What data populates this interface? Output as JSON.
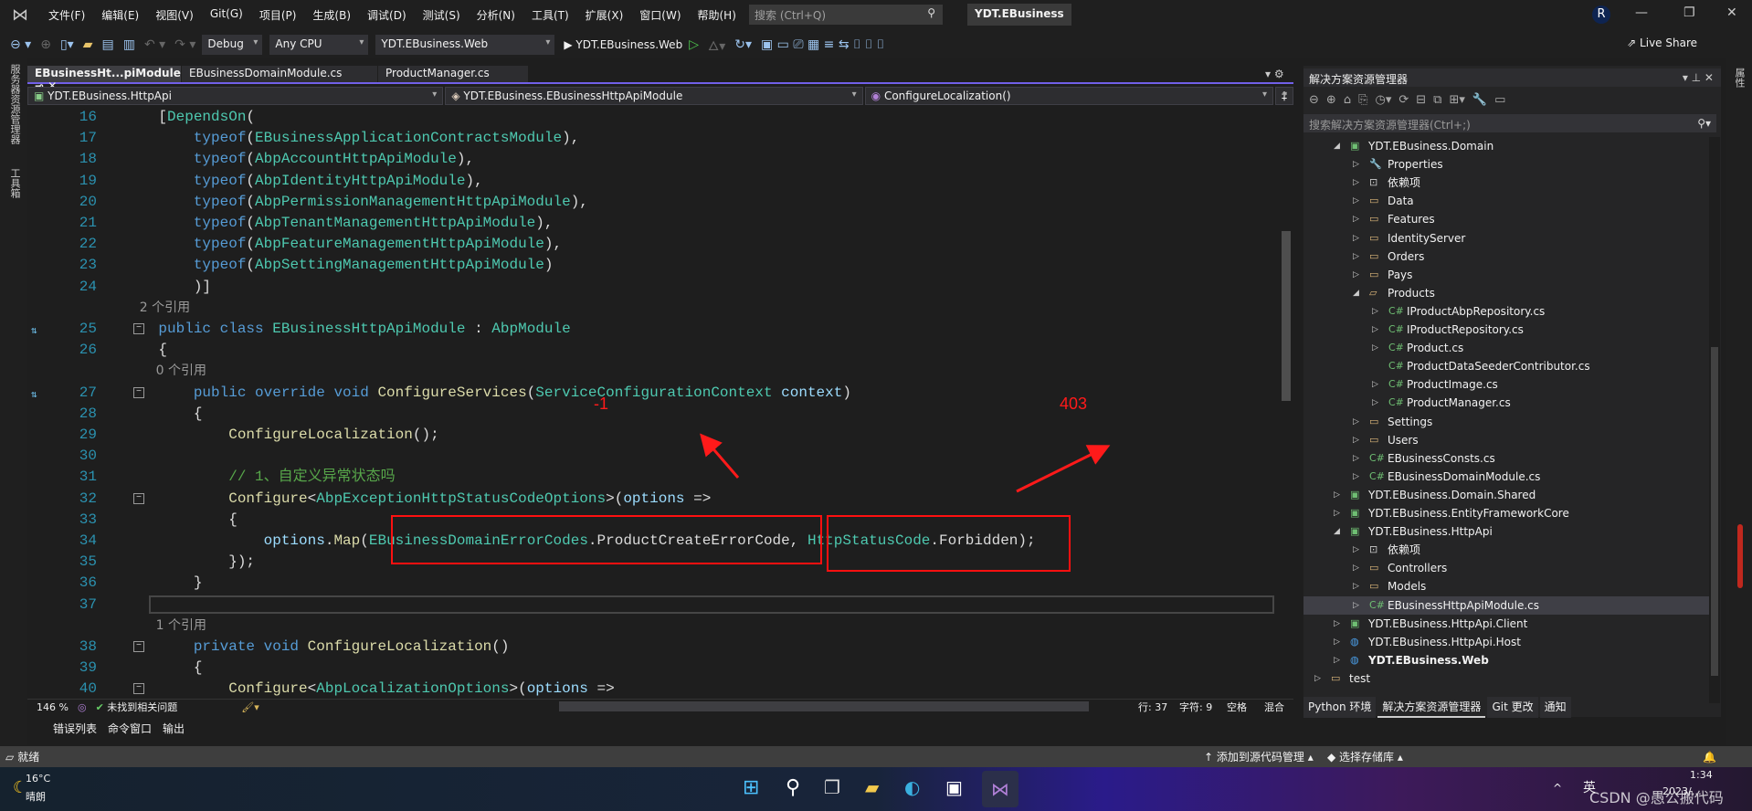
{
  "menu": {
    "items": [
      "文件(F)",
      "编辑(E)",
      "视图(V)",
      "Git(G)",
      "项目(P)",
      "生成(B)",
      "调试(D)",
      "测试(S)",
      "分析(N)",
      "工具(T)",
      "扩展(X)",
      "窗口(W)",
      "帮助(H)"
    ],
    "search_placeholder": "搜索 (Ctrl+Q)",
    "solution_name": "YDT.EBusiness",
    "avatar": "R"
  },
  "toolbar": {
    "config": "Debug",
    "platform": "Any CPU",
    "startup": "YDT.EBusiness.Web",
    "run": "▶ YDT.EBusiness.Web",
    "live_share": "Live Share"
  },
  "left_strip": {
    "items": [
      "服务器资源管理器",
      "工具箱"
    ]
  },
  "right_strip": {
    "items": [
      "属性"
    ]
  },
  "tabs": [
    {
      "label": "EBusinessHt...piModule.cs",
      "active": true
    },
    {
      "label": "EBusinessDomainModule.cs"
    },
    {
      "label": "ProductManager.cs"
    }
  ],
  "navbar": {
    "project": "YDT.EBusiness.HttpApi",
    "class": "YDT.EBusiness.EBusinessHttpApiModule",
    "member": "ConfigureLocalization()"
  },
  "code": [
    {
      "n": "16",
      "t": [
        [
          "    ",
          "pl"
        ],
        [
          "[",
          "pl"
        ],
        [
          "DependsOn",
          "ty"
        ],
        [
          "(",
          "pl"
        ]
      ]
    },
    {
      "n": "17",
      "t": [
        [
          "        typeof",
          "kw"
        ],
        [
          "(",
          "pl"
        ],
        [
          "EBusinessApplicationContractsModule",
          "ty"
        ],
        [
          "),",
          "pl"
        ]
      ]
    },
    {
      "n": "18",
      "t": [
        [
          "        typeof",
          "kw"
        ],
        [
          "(",
          "pl"
        ],
        [
          "AbpAccountHttpApiModule",
          "ty"
        ],
        [
          "),",
          "pl"
        ]
      ]
    },
    {
      "n": "19",
      "t": [
        [
          "        typeof",
          "kw"
        ],
        [
          "(",
          "pl"
        ],
        [
          "AbpIdentityHttpApiModule",
          "ty"
        ],
        [
          "),",
          "pl"
        ]
      ]
    },
    {
      "n": "20",
      "t": [
        [
          "        typeof",
          "kw"
        ],
        [
          "(",
          "pl"
        ],
        [
          "AbpPermissionManagementHttpApiModule",
          "ty"
        ],
        [
          "),",
          "pl"
        ]
      ]
    },
    {
      "n": "21",
      "t": [
        [
          "        typeof",
          "kw"
        ],
        [
          "(",
          "pl"
        ],
        [
          "AbpTenantManagementHttpApiModule",
          "ty"
        ],
        [
          "),",
          "pl"
        ]
      ]
    },
    {
      "n": "22",
      "t": [
        [
          "        typeof",
          "kw"
        ],
        [
          "(",
          "pl"
        ],
        [
          "AbpFeatureManagementHttpApiModule",
          "ty"
        ],
        [
          "),",
          "pl"
        ]
      ]
    },
    {
      "n": "23",
      "t": [
        [
          "        typeof",
          "kw"
        ],
        [
          "(",
          "pl"
        ],
        [
          "AbpSettingManagementHttpApiModule",
          "ty"
        ],
        [
          ")",
          "pl"
        ]
      ]
    },
    {
      "n": "24",
      "t": [
        [
          "        )]",
          "pl"
        ]
      ]
    },
    {
      "n": "",
      "t": [
        [
          "    2 个引用",
          "lens"
        ]
      ]
    },
    {
      "n": "25",
      "fold": true,
      "glyph": true,
      "t": [
        [
          "    public class ",
          "kw"
        ],
        [
          "EBusinessHttpApiModule",
          "ty"
        ],
        [
          " : ",
          "pl"
        ],
        [
          "AbpModule",
          "ty"
        ]
      ]
    },
    {
      "n": "26",
      "t": [
        [
          "    {",
          "pl"
        ]
      ]
    },
    {
      "n": "",
      "t": [
        [
          "        0 个引用",
          "lens"
        ]
      ]
    },
    {
      "n": "27",
      "fold": true,
      "glyph": true,
      "t": [
        [
          "        public override void ",
          "kw"
        ],
        [
          "ConfigureServices",
          "me"
        ],
        [
          "(",
          "pl"
        ],
        [
          "ServiceConfigurationContext",
          "ty"
        ],
        [
          " context",
          "pa"
        ],
        [
          ")",
          "pl"
        ]
      ]
    },
    {
      "n": "28",
      "t": [
        [
          "        {",
          "pl"
        ]
      ]
    },
    {
      "n": "29",
      "t": [
        [
          "            ",
          "pl"
        ],
        [
          "ConfigureLocalization",
          "me"
        ],
        [
          "();",
          "pl"
        ]
      ]
    },
    {
      "n": "30",
      "t": [
        [
          "",
          "pl"
        ]
      ]
    },
    {
      "n": "31",
      "t": [
        [
          "            // 1、自定义异常状态吗",
          "cm"
        ]
      ]
    },
    {
      "n": "32",
      "fold": true,
      "t": [
        [
          "            ",
          "pl"
        ],
        [
          "Configure",
          "me"
        ],
        [
          "<",
          "pl"
        ],
        [
          "AbpExceptionHttpStatusCodeOptions",
          "ty"
        ],
        [
          ">(",
          "pl"
        ],
        [
          "options",
          "pa"
        ],
        [
          " =>",
          "pl"
        ]
      ]
    },
    {
      "n": "33",
      "t": [
        [
          "            {",
          "pl"
        ]
      ]
    },
    {
      "n": "34",
      "t": [
        [
          "                options",
          "pa"
        ],
        [
          ".",
          "pl"
        ],
        [
          "Map",
          "me"
        ],
        [
          "(",
          "pl"
        ],
        [
          "EBusinessDomainErrorCodes",
          "ty"
        ],
        [
          ".ProductCreateErrorCode, ",
          "pl"
        ],
        [
          "HttpStatusCode",
          "ty"
        ],
        [
          ".Forbidden);",
          "pl"
        ]
      ]
    },
    {
      "n": "35",
      "t": [
        [
          "            });",
          "pl"
        ]
      ]
    },
    {
      "n": "36",
      "t": [
        [
          "        }",
          "pl"
        ]
      ]
    },
    {
      "n": "37",
      "t": [
        [
          "",
          "pl"
        ]
      ]
    },
    {
      "n": "",
      "t": [
        [
          "        1 个引用",
          "lens"
        ]
      ]
    },
    {
      "n": "38",
      "fold": true,
      "t": [
        [
          "        private void ",
          "kw"
        ],
        [
          "ConfigureLocalization",
          "me"
        ],
        [
          "()",
          "pl"
        ]
      ]
    },
    {
      "n": "39",
      "t": [
        [
          "        {",
          "pl"
        ]
      ]
    },
    {
      "n": "40",
      "fold": true,
      "t": [
        [
          "            ",
          "pl"
        ],
        [
          "Configure",
          "me"
        ],
        [
          "<",
          "pl"
        ],
        [
          "AbpLocalizationOptions",
          "ty"
        ],
        [
          ">(",
          "pl"
        ],
        [
          "options",
          "pa"
        ],
        [
          " =>",
          "pl"
        ]
      ]
    }
  ],
  "annotations": {
    "left_label": "-1",
    "right_label": "403",
    "color": "#ff1a1a"
  },
  "editor_status": {
    "zoom": "146 %",
    "issues": "未找到相关问题",
    "line": "行: 37",
    "char": "字符: 9",
    "spaces": "空格",
    "line_ending": "混合"
  },
  "bottom_tabs": [
    "错误列表",
    "命令窗口",
    "输出"
  ],
  "statusbar": {
    "ready": "就绪",
    "add_source": "添加到源代码管理",
    "select_repo": "选择存储库"
  },
  "solution_explorer": {
    "title": "解决方案资源管理器",
    "search_placeholder": "搜索解决方案资源管理器(Ctrl+;)",
    "tree": [
      {
        "label": "YDT.EBusiness.Domain",
        "d": 1,
        "icon": "csproj",
        "exp": "open"
      },
      {
        "label": "Properties",
        "d": 2,
        "icon": "props",
        "exp": "closed"
      },
      {
        "label": "依赖项",
        "d": 2,
        "icon": "deps",
        "exp": "closed"
      },
      {
        "label": "Data",
        "d": 2,
        "icon": "folder",
        "exp": "closed"
      },
      {
        "label": "Features",
        "d": 2,
        "icon": "folder",
        "exp": "closed"
      },
      {
        "label": "IdentityServer",
        "d": 2,
        "icon": "folder",
        "exp": "closed"
      },
      {
        "label": "Orders",
        "d": 2,
        "icon": "folder",
        "exp": "closed"
      },
      {
        "label": "Pays",
        "d": 2,
        "icon": "folder",
        "exp": "closed"
      },
      {
        "label": "Products",
        "d": 2,
        "icon": "folder-open",
        "exp": "open"
      },
      {
        "label": "IProductAbpRepository.cs",
        "d": 3,
        "icon": "cs",
        "exp": "closed"
      },
      {
        "label": "IProductRepository.cs",
        "d": 3,
        "icon": "cs",
        "exp": "closed"
      },
      {
        "label": "Product.cs",
        "d": 3,
        "icon": "cs",
        "exp": "closed"
      },
      {
        "label": "ProductDataSeederContributor.cs",
        "d": 3,
        "icon": "cs",
        "exp": "none"
      },
      {
        "label": "ProductImage.cs",
        "d": 3,
        "icon": "cs",
        "exp": "closed"
      },
      {
        "label": "ProductManager.cs",
        "d": 3,
        "icon": "cs",
        "exp": "closed"
      },
      {
        "label": "Settings",
        "d": 2,
        "icon": "folder",
        "exp": "closed"
      },
      {
        "label": "Users",
        "d": 2,
        "icon": "folder",
        "exp": "closed"
      },
      {
        "label": "EBusinessConsts.cs",
        "d": 2,
        "icon": "cs",
        "exp": "closed"
      },
      {
        "label": "EBusinessDomainModule.cs",
        "d": 2,
        "icon": "cs",
        "exp": "closed"
      },
      {
        "label": "YDT.EBusiness.Domain.Shared",
        "d": 1,
        "icon": "csproj",
        "exp": "closed"
      },
      {
        "label": "YDT.EBusiness.EntityFrameworkCore",
        "d": 1,
        "icon": "csproj",
        "exp": "closed"
      },
      {
        "label": "YDT.EBusiness.HttpApi",
        "d": 1,
        "icon": "csproj",
        "exp": "open"
      },
      {
        "label": "依赖项",
        "d": 2,
        "icon": "deps",
        "exp": "closed"
      },
      {
        "label": "Controllers",
        "d": 2,
        "icon": "folder",
        "exp": "closed"
      },
      {
        "label": "Models",
        "d": 2,
        "icon": "folder",
        "exp": "closed"
      },
      {
        "label": "EBusinessHttpApiModule.cs",
        "d": 2,
        "icon": "cs",
        "exp": "closed",
        "selected": true
      },
      {
        "label": "YDT.EBusiness.HttpApi.Client",
        "d": 1,
        "icon": "csproj",
        "exp": "closed"
      },
      {
        "label": "YDT.EBusiness.HttpApi.Host",
        "d": 1,
        "icon": "web",
        "exp": "closed"
      },
      {
        "label": "YDT.EBusiness.Web",
        "d": 1,
        "icon": "web",
        "exp": "closed",
        "bold": true
      },
      {
        "label": "test",
        "d": 0,
        "icon": "folder",
        "exp": "closed"
      }
    ],
    "tabs": [
      {
        "label": "Python 环境"
      },
      {
        "label": "解决方案资源管理器",
        "active": true
      },
      {
        "label": "Git 更改"
      },
      {
        "label": "通知"
      }
    ]
  },
  "taskbar": {
    "weather_temp": "16°C",
    "weather_desc": "晴朗",
    "ime": "英",
    "time": "1:34",
    "date": "2023/…",
    "watermark": "CSDN @愚公搬代码"
  }
}
